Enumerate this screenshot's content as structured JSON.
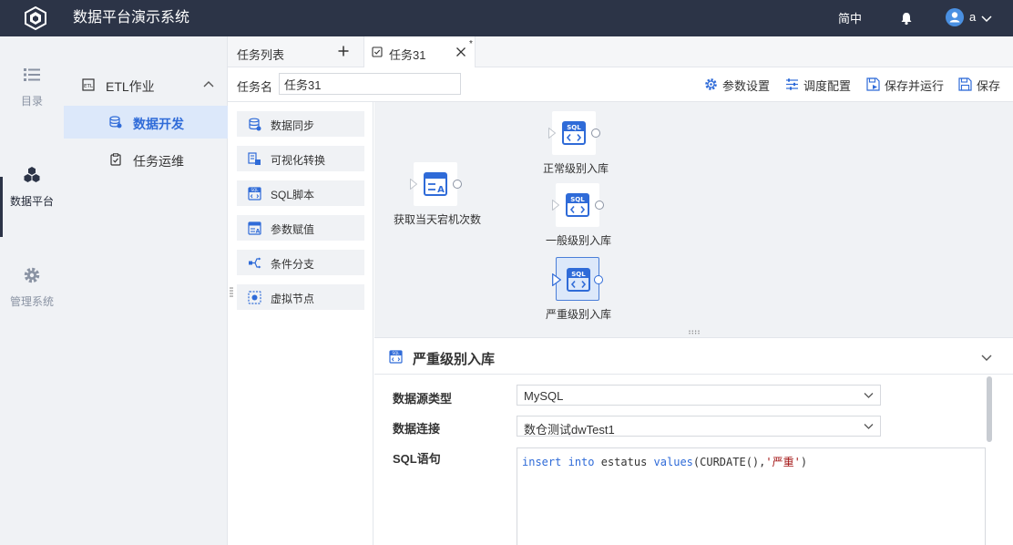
{
  "header": {
    "app_title": "数据平台演示系统",
    "language": "简中",
    "user_name": "a",
    "logo_icon": "cube-logo-icon",
    "notification_icon": "bell-icon"
  },
  "nav_primary": [
    {
      "label": "目录",
      "icon": "list-icon",
      "active": false
    },
    {
      "label": "数据平台",
      "icon": "cubes-icon",
      "active": true
    },
    {
      "label": "管理系统",
      "icon": "gear-icon",
      "active": false
    }
  ],
  "nav_secondary": {
    "group_label": "ETL作业",
    "items": [
      {
        "label": "数据开发",
        "active": true
      },
      {
        "label": "任务运维",
        "active": false
      }
    ]
  },
  "tabs": {
    "list_label": "任务列表",
    "active_tab_label": "任务31",
    "modified_marker": "*"
  },
  "toolbar": {
    "task_name_label": "任务名",
    "task_name_value": "任务31",
    "param_settings": "参数设置",
    "schedule_config": "调度配置",
    "save_and_run": "保存并运行",
    "save": "保存"
  },
  "palette": [
    {
      "label": "数据同步",
      "icon": "data-sync-icon"
    },
    {
      "label": "可视化转换",
      "icon": "visual-transform-icon"
    },
    {
      "label": "SQL脚本",
      "icon": "sql-script-icon"
    },
    {
      "label": "参数赋值",
      "icon": "param-assign-icon"
    },
    {
      "label": "条件分支",
      "icon": "branch-icon"
    },
    {
      "label": "虚拟节点",
      "icon": "virtual-node-icon"
    }
  ],
  "canvas_nodes": {
    "param_node": "获取当天宕机次数",
    "sql_normal": "正常级别入库",
    "sql_general": "一般级别入库",
    "sql_severe": "严重级别入库"
  },
  "properties": {
    "title": "严重级别入库",
    "datasource_type_label": "数据源类型",
    "datasource_type_value": "MySQL",
    "connection_label": "数据连接",
    "connection_value": "数仓测试dwTest1",
    "sql_label": "SQL语句",
    "sql": {
      "kw_insert": "insert",
      "kw_into": "into",
      "table": "estatus",
      "kw_values": "values",
      "args_open": "(CURDATE(),",
      "str": "'严重'",
      "args_close": ")"
    }
  },
  "colors": {
    "header_bg": "#2c3447",
    "accent": "#2f6bd8",
    "nav_bg": "#f0f2f5",
    "active_item_bg": "#dce8fa"
  }
}
